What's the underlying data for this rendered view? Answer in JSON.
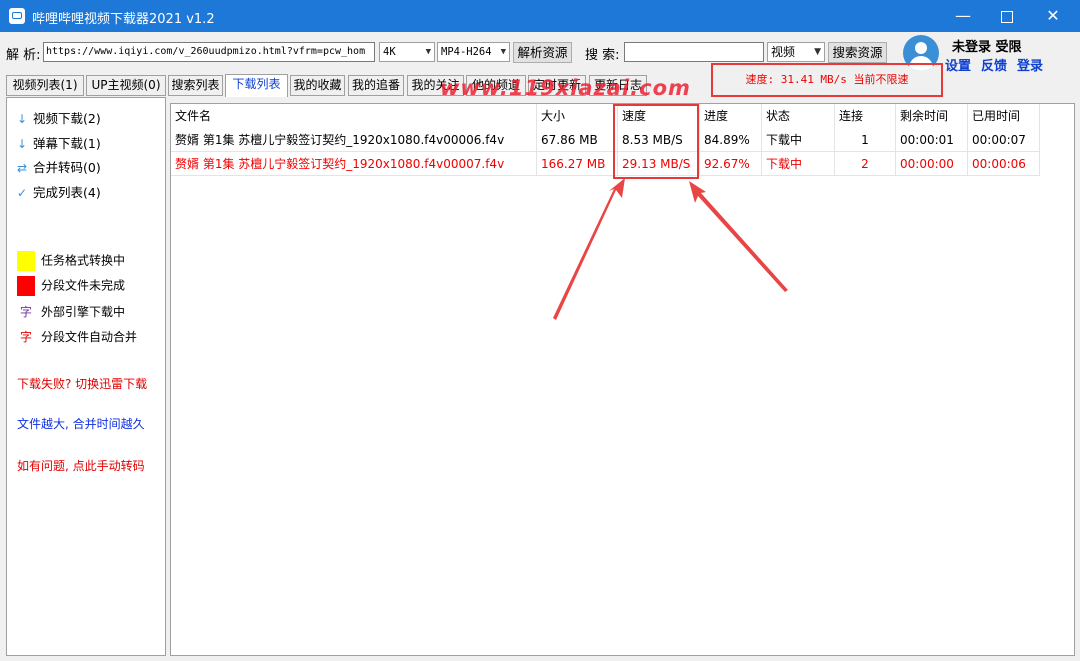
{
  "window": {
    "title": "哔哩哔哩视频下载器2021 v1.2"
  },
  "toolbar": {
    "parse_label": "解 析:",
    "url_value": "https://www.iqiyi.com/v_260uudpmizo.html?vfrm=pcw_hom",
    "quality": "4K",
    "format": "MP4-H264",
    "parse_button": "解析资源",
    "search_label": "搜 索:",
    "search_value": "",
    "search_type": "视频",
    "search_button": "搜索资源"
  },
  "user": {
    "status": "未登录 受限",
    "settings": "设置",
    "feedback": "反馈",
    "login": "登录"
  },
  "speed": {
    "text": "速度: 31.41 MB/s  当前不限速"
  },
  "tabs": [
    "视频列表(1)",
    "UP主视频(0)",
    "搜索列表",
    "下载列表",
    "我的收藏",
    "我的追番",
    "我的关注",
    "他的频道",
    "定时更新",
    "更新日志"
  ],
  "watermark": "www.119xiazai.com",
  "sidebar": {
    "items": [
      {
        "icon": "arrow-down-icon",
        "glyph": "↓",
        "label": "视频下载(2)"
      },
      {
        "icon": "arrow-down-icon",
        "glyph": "↓",
        "label": "弹幕下载(1)"
      },
      {
        "icon": "merge-icon",
        "glyph": "⇄",
        "label": "合并转码(0)"
      },
      {
        "icon": "check-icon",
        "glyph": "✓",
        "label": "完成列表(4)"
      }
    ],
    "legend": [
      {
        "color": "#ffff00",
        "label": "任务格式转换中"
      },
      {
        "color": "#ff0000",
        "label": "分段文件未完成"
      },
      {
        "glyph": "字",
        "glyph_color": "#7030a0",
        "label": "外部引擎下载中"
      },
      {
        "glyph": "字",
        "glyph_color": "#e00000",
        "label": "分段文件自动合并"
      }
    ],
    "notices": [
      {
        "text": "下载失败? 切换迅雷下载",
        "color": "#e00000"
      },
      {
        "text": "文件越大, 合并时间越久",
        "color": "#1030e0"
      },
      {
        "text": "如有问题, 点此手动转码",
        "color": "#e00000"
      }
    ]
  },
  "table": {
    "headers": [
      "文件名",
      "大小",
      "速度",
      "进度",
      "状态",
      "连接",
      "剩余时间",
      "已用时间"
    ],
    "rows": [
      {
        "name": "赘婿 第1集 苏檀儿宁毅签订契约_1920x1080.f4v00006.f4v",
        "size": "67.86 MB",
        "speed": "8.53 MB/S",
        "progress": "84.89%",
        "status": "下载中",
        "conn": "1",
        "remain": "00:00:01",
        "used": "00:00:07",
        "color": "#000000"
      },
      {
        "name": "赘婿 第1集 苏檀儿宁毅签订契约_1920x1080.f4v00007.f4v",
        "size": "166.27 MB",
        "speed": "29.13 MB/S",
        "progress": "92.67%",
        "status": "下载中",
        "conn": "2",
        "remain": "00:00:00",
        "used": "00:00:06",
        "color": "#e00000"
      }
    ]
  },
  "colors": {
    "accent": "#1e78d7",
    "highlight": "#e63a3a"
  }
}
